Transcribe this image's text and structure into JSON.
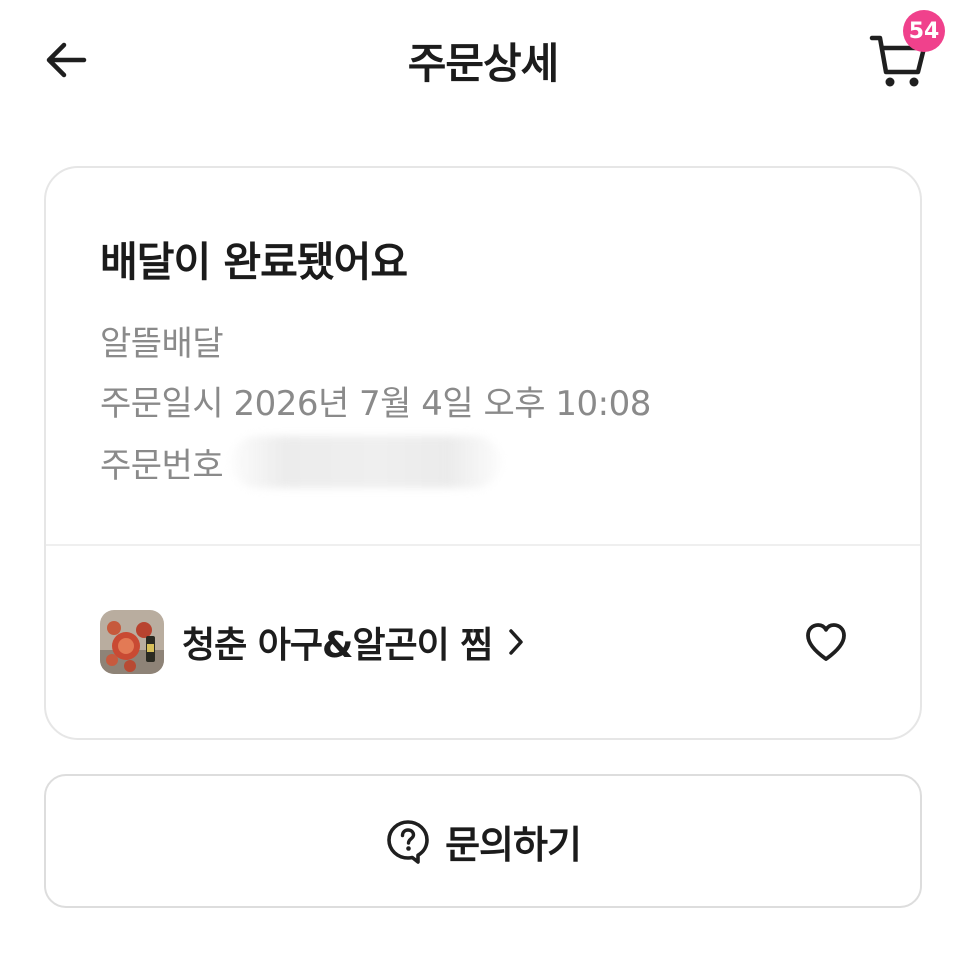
{
  "header": {
    "title": "주문상세",
    "back_icon": "back-arrow-icon",
    "cart_icon": "cart-icon",
    "cart_badge_count": "54",
    "badge_color": "#f0418c"
  },
  "order": {
    "status_title": "배달이 완료됐어요",
    "delivery_type": "알뜰배달",
    "order_date_label": "주문일시",
    "order_date_value": "2026년 7월 4일 오후 10:08",
    "order_number_label": "주문번호",
    "store": {
      "name": "청춘 아구&알곤이 찜",
      "thumbnail_icon": "store-thumbnail",
      "chevron_icon": "chevron-right-icon",
      "favorite_icon": "heart-icon"
    }
  },
  "actions": {
    "inquiry_label": "문의하기",
    "inquiry_icon": "question-bubble-icon"
  }
}
